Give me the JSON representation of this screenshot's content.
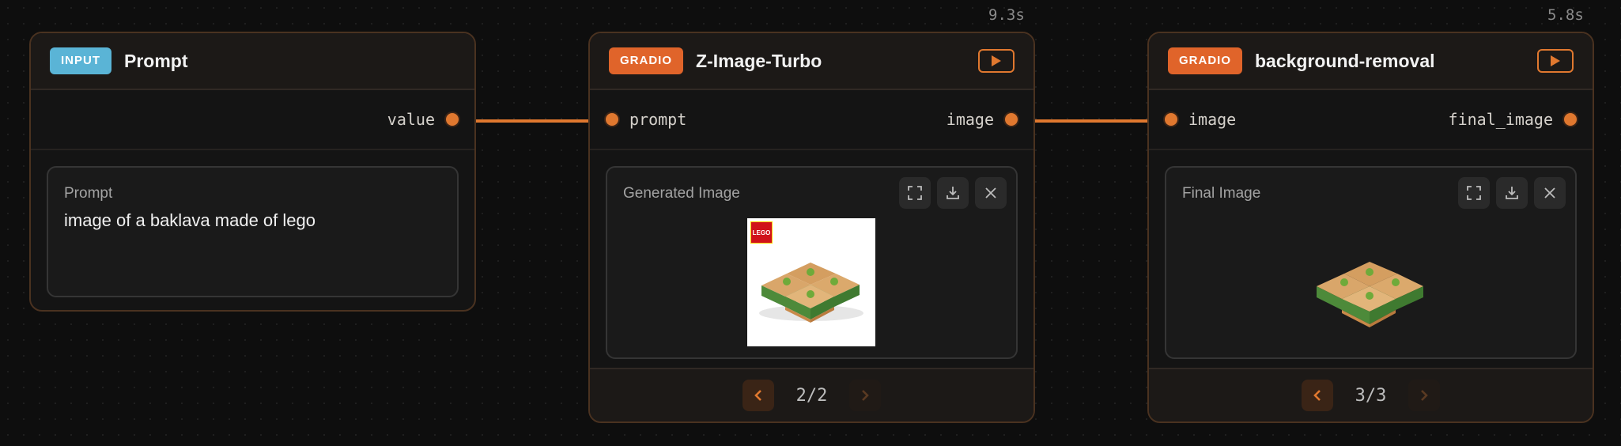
{
  "timings": {
    "zimage": "9.3s",
    "bgremoval": "5.8s"
  },
  "nodes": {
    "prompt": {
      "badge": "INPUT",
      "title": "Prompt",
      "output_port": "value",
      "panel_label": "Prompt",
      "panel_value": "image of a baklava made of lego"
    },
    "zimage": {
      "badge": "GRADIO",
      "title": "Z-Image-Turbo",
      "input_port": "prompt",
      "output_port": "image",
      "panel_label": "Generated Image",
      "pager": "2/2",
      "logo_text": "LEGO"
    },
    "bgremoval": {
      "badge": "GRADIO",
      "title": "background-removal",
      "input_port": "image",
      "output_port": "final_image",
      "panel_label": "Final Image",
      "pager": "3/3"
    }
  },
  "colors": {
    "accent": "#e0782f",
    "input_badge": "#5ab4d6",
    "gradio_badge": "#e0642a"
  },
  "icons": {
    "run": "play-icon",
    "fullscreen": "fullscreen-icon",
    "download": "download-icon",
    "close": "close-icon",
    "prev": "chevron-left-icon",
    "next": "chevron-right-icon"
  }
}
